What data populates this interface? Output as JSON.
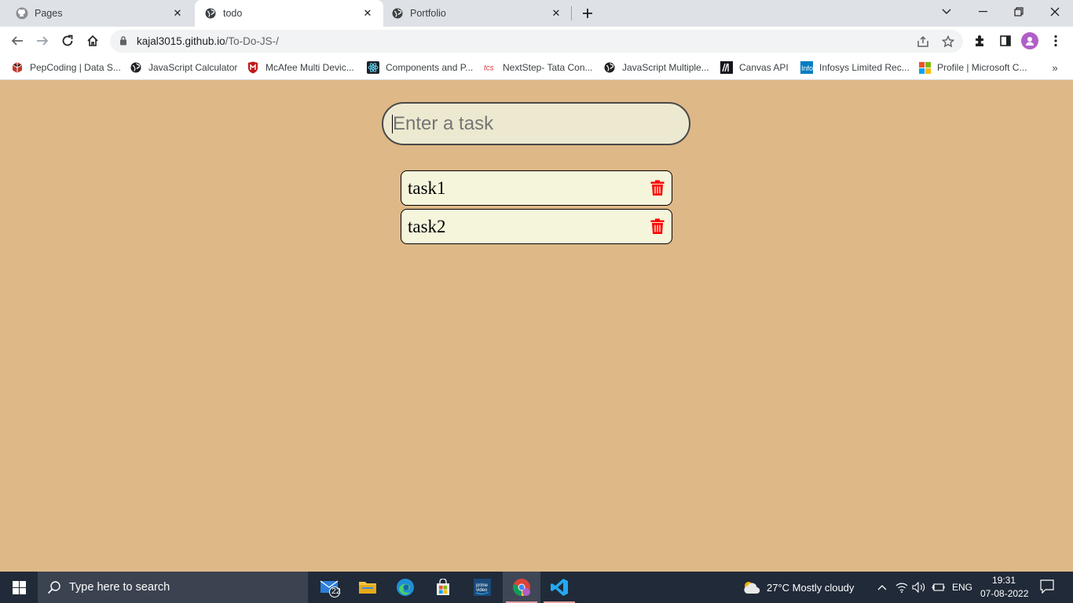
{
  "browser": {
    "tabs": [
      {
        "title": "Pages",
        "icon": "github-icon",
        "active": false
      },
      {
        "title": "todo",
        "icon": "globe-icon",
        "active": true
      },
      {
        "title": "Portfolio",
        "icon": "globe-icon",
        "active": false
      }
    ],
    "url_host": "kajal3015.github.io",
    "url_path": "/To-Do-JS-/",
    "bookmarks": [
      {
        "label": "PepCoding | Data S...",
        "icon": "pepcoding-icon"
      },
      {
        "label": "JavaScript Calculator",
        "icon": "globe-icon"
      },
      {
        "label": "McAfee Multi Devic...",
        "icon": "mcafee-icon"
      },
      {
        "label": "Components and P...",
        "icon": "react-icon"
      },
      {
        "label": "NextStep- Tata Con...",
        "icon": "tcs-icon"
      },
      {
        "label": "JavaScript Multiple...",
        "icon": "globe-icon"
      },
      {
        "label": "Canvas API",
        "icon": "mdn-icon"
      },
      {
        "label": "Infosys Limited Rec...",
        "icon": "infosys-icon"
      },
      {
        "label": "Profile | Microsoft C...",
        "icon": "microsoft-icon"
      }
    ],
    "bookmarks_more": "»"
  },
  "todo": {
    "input_placeholder": "Enter a task",
    "tasks": [
      {
        "text": "task1"
      },
      {
        "text": "task2"
      }
    ],
    "colors": {
      "background": "#deb887",
      "task_bg": "#f5f5dc",
      "delete": "#ff0000"
    }
  },
  "taskbar": {
    "search_placeholder": "Type here to search",
    "mail_badge": "22",
    "weather": "27°C  Mostly cloudy",
    "language": "ENG",
    "time": "19:31",
    "date": "07-08-2022"
  }
}
